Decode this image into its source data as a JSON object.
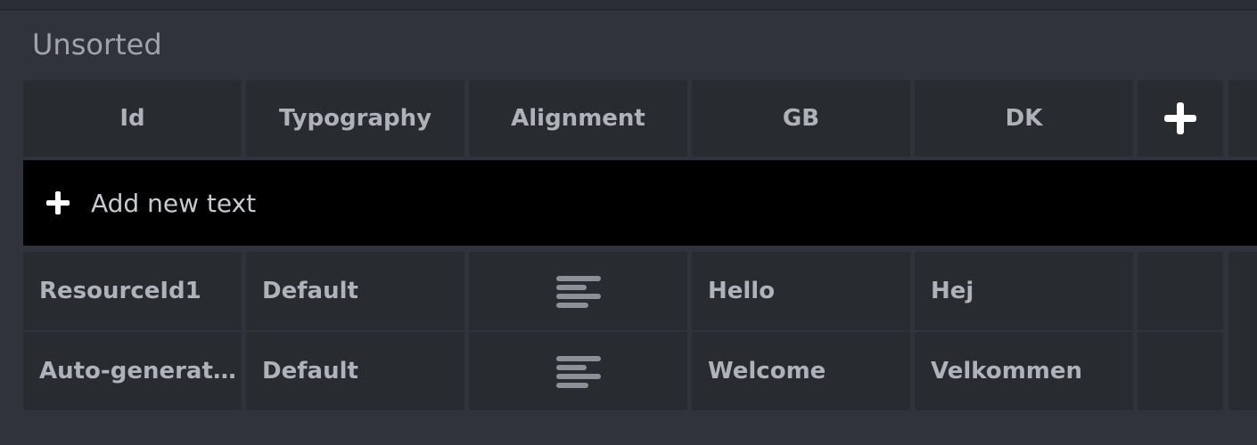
{
  "section": {
    "title": "Unsorted"
  },
  "table": {
    "headers": [
      "Id",
      "Typography",
      "Alignment",
      "GB",
      "DK"
    ],
    "add_column_icon": "plus-icon",
    "add_row_label": "Add new text",
    "add_row_icon": "plus-icon",
    "rows": [
      {
        "id": "ResourceId1",
        "typography": "Default",
        "alignment": "align-left-icon",
        "gb": "Hello",
        "dk": "Hej"
      },
      {
        "id": "Auto-generat…",
        "typography": "Default",
        "alignment": "align-left-icon",
        "gb": "Welcome",
        "dk": "Velkommen"
      }
    ]
  },
  "colors": {
    "background": "#30333c",
    "cell": "#282b2f",
    "add_row": "#000000",
    "text": "#aeb3ba"
  }
}
